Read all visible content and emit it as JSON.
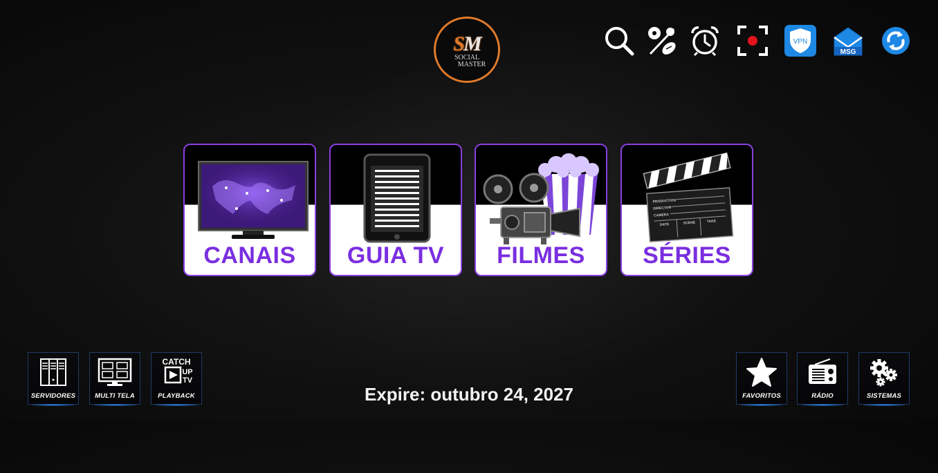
{
  "logo": {
    "mark_left": "S",
    "mark_right": "M",
    "line1": "SOCIAL",
    "line2": "MASTER"
  },
  "top_icons": [
    "search-icon",
    "sports-icon",
    "alarm-icon",
    "record-icon",
    "vpn-icon",
    "msg-icon",
    "refresh-icon"
  ],
  "top": {
    "vpn_label": "VPN",
    "msg_label": "MSG"
  },
  "tiles": [
    {
      "label": "CANAIS",
      "icon": "tv-map-icon"
    },
    {
      "label": "GUIA TV",
      "icon": "tablet-guide-icon"
    },
    {
      "label": "FILMES",
      "icon": "projector-popcorn-icon"
    },
    {
      "label": "SÉRIES",
      "icon": "clapperboard-icon"
    }
  ],
  "clapper_text": {
    "production": "PRODUCTION",
    "director": "DIRECTOR",
    "camera": "CAMERA",
    "date": "DATE",
    "scene": "SCENE",
    "take": "TAKE"
  },
  "bottom_left": [
    {
      "label": "SERVIDORES",
      "icon": "server-icon"
    },
    {
      "label": "MULTI TELA",
      "icon": "multiscreen-icon"
    },
    {
      "label": "PLAYBACK",
      "icon": "catchup-icon",
      "icon_text": [
        "CATCH",
        "UP",
        "TV"
      ]
    }
  ],
  "bottom_right": [
    {
      "label": "FAVORITOS",
      "icon": "star-icon"
    },
    {
      "label": "RÁDIO",
      "icon": "radio-icon"
    },
    {
      "label": "SISTEMAS",
      "icon": "gears-icon"
    }
  ],
  "expire_text": "Expire: outubro 24, 2027",
  "colors": {
    "accent": "#7a2ee0",
    "logo_ring": "#e07a2b",
    "vpn_blue": "#1e88e5",
    "glow": "#2f8cff"
  }
}
